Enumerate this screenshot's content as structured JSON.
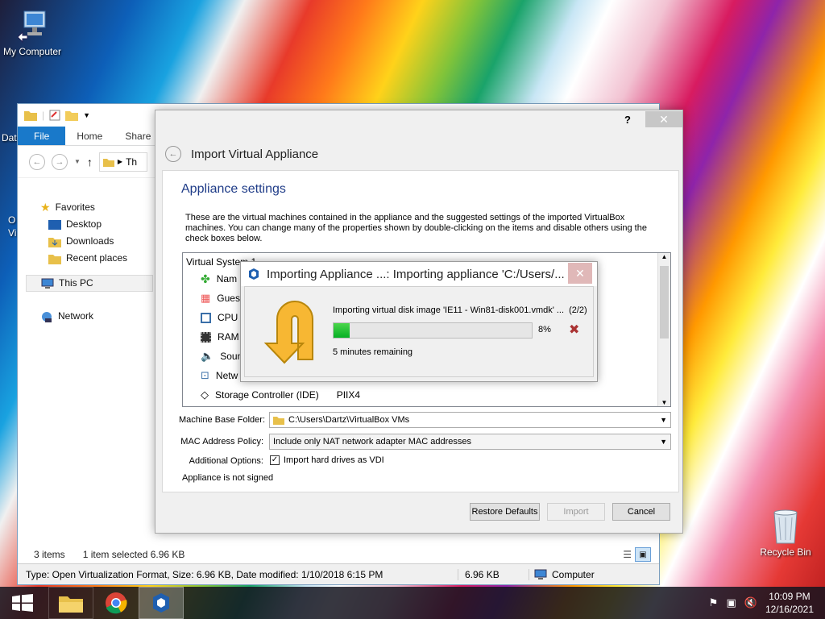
{
  "desktop": {
    "icons": [
      {
        "label": "My Computer"
      },
      {
        "label": "Recycle Bin"
      }
    ],
    "partial_labels": [
      "Dat",
      "O",
      "Vi"
    ]
  },
  "explorer": {
    "tabs": [
      "File",
      "Home",
      "Share"
    ],
    "address_partial": "Th",
    "nav": {
      "favorites": "Favorites",
      "favorites_items": [
        "Desktop",
        "Downloads",
        "Recent places"
      ],
      "this_pc": "This PC",
      "network": "Network"
    },
    "status": {
      "items_count": "3 items",
      "selection": "1 item selected  6.96 KB"
    },
    "info_bar": {
      "details": "Type: Open Virtualization Format, Size: 6.96 KB, Date modified: 1/10/2018 6:15 PM",
      "size": "6.96 KB",
      "location": "Computer"
    }
  },
  "import_dialog": {
    "help": "?",
    "title": "Import Virtual Appliance",
    "section": "Appliance settings",
    "description": "These are the virtual machines contained in the appliance and the suggested settings of the imported VirtualBox machines. You can change many of the properties shown by double-clicking on the items and disable others using the check boxes below.",
    "tree_header": "Virtual System 1",
    "tree_items": [
      "Nam",
      "Gues",
      "CPU",
      "RAM",
      "Soun",
      "Netw"
    ],
    "storage_label": "Storage Controller (IDE)",
    "storage_value": "PIIX4",
    "base_folder_label": "Machine Base Folder:",
    "base_folder_value": "C:\\Users\\Dartz\\VirtualBox VMs",
    "mac_label": "MAC Address Policy:",
    "mac_value": "Include only NAT network adapter MAC addresses",
    "additional_label": "Additional Options:",
    "import_vdi_label": "Import hard drives as VDI",
    "import_vdi_checked": true,
    "signed_status": "Appliance is not signed",
    "buttons": {
      "restore": "Restore Defaults",
      "import": "Import",
      "cancel": "Cancel"
    }
  },
  "progress_dialog": {
    "title": "Importing Appliance ...: Importing appliance 'C:/Users/...",
    "operation": "Importing virtual disk image 'IE11 - Win81-disk001.vmdk' ...",
    "step": "(2/2)",
    "percent_label": "8%",
    "progress": 0.08,
    "remaining": "5 minutes remaining"
  },
  "taskbar": {
    "time": "10:09 PM",
    "date": "12/16/2021"
  },
  "colors": {
    "accent": "#1979ca",
    "progress_fill": "#06b025",
    "dialog_heading": "#1f3c88"
  }
}
